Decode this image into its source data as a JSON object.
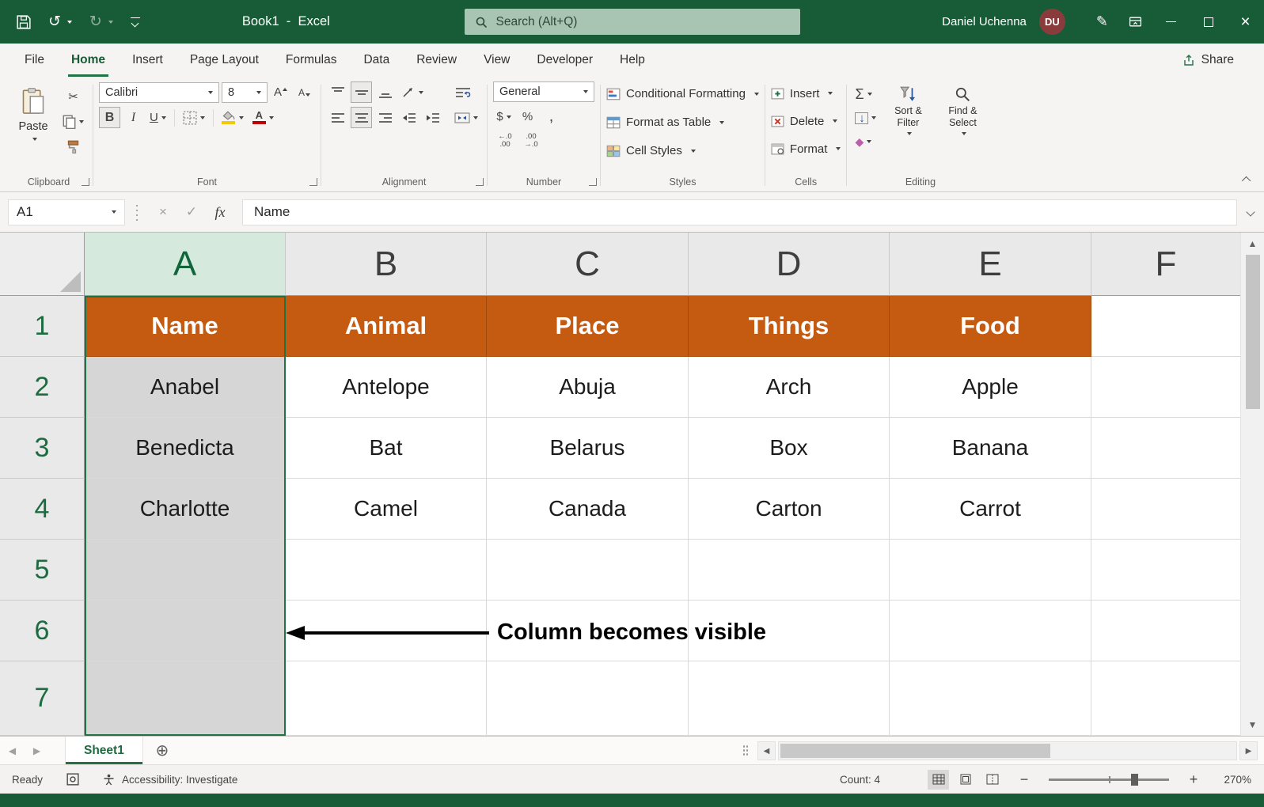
{
  "colors": {
    "title_bar_green": "#185C37",
    "accent_green": "#217346",
    "header_fill_orange": "#C55A11",
    "selected_column_gray": "#D6D6D6",
    "selected_header_green": "#D5E9DD",
    "font_color_bar_red": "#C00000",
    "fill_color_bar_yellow": "#F2C811"
  },
  "title_bar": {
    "title": "Book1  -  Excel",
    "search_placeholder": "Search (Alt+Q)",
    "user_name": "Daniel Uchenna",
    "user_initials": "DU"
  },
  "tabs": {
    "items": [
      "File",
      "Home",
      "Insert",
      "Page Layout",
      "Formulas",
      "Data",
      "Review",
      "View",
      "Developer",
      "Help"
    ],
    "active": "Home",
    "share": "Share"
  },
  "ribbon": {
    "clipboard": {
      "paste": "Paste",
      "label": "Clipboard"
    },
    "font": {
      "name": "Calibri",
      "size": "8",
      "bold": "B",
      "italic": "I",
      "underline": "U",
      "label": "Font"
    },
    "alignment": {
      "label": "Alignment"
    },
    "number": {
      "format": "General",
      "currency": "$",
      "percent": "%",
      "comma": ",",
      "inc_decimal": "←.0\n.00",
      "dec_decimal": ".00\n→.0",
      "label": "Number"
    },
    "styles": {
      "conditional": "Conditional Formatting",
      "format_table": "Format as Table",
      "cell_styles": "Cell Styles",
      "label": "Styles"
    },
    "cells": {
      "insert": "Insert",
      "delete": "Delete",
      "format": "Format",
      "label": "Cells"
    },
    "editing": {
      "autosum": "Σ",
      "fill": "↓",
      "clear": "◆",
      "sort_filter": "Sort & Filter",
      "find_select": "Find & Select",
      "label": "Editing"
    }
  },
  "formula_bar": {
    "name_box": "A1",
    "cancel": "×",
    "enter": "✓",
    "fx": "fx",
    "content": "Name"
  },
  "sheet": {
    "col_headers": [
      "A",
      "B",
      "C",
      "D",
      "E",
      "F"
    ],
    "row_headers": [
      "1",
      "2",
      "3",
      "4",
      "5",
      "6",
      "7"
    ],
    "rows": [
      [
        "Name",
        "Animal",
        "Place",
        "Things",
        "Food"
      ],
      [
        "Anabel",
        "Antelope",
        "Abuja",
        "Arch",
        "Apple"
      ],
      [
        "Benedicta",
        "Bat",
        "Belarus",
        "Box",
        "Banana"
      ],
      [
        "Charlotte",
        "Camel",
        "Canada",
        "Carton",
        "Carrot"
      ],
      [
        "",
        "",
        "",
        "",
        ""
      ],
      [
        "",
        "",
        "",
        "",
        ""
      ],
      [
        "",
        "",
        "",
        "",
        ""
      ]
    ],
    "annotation": "Column becomes visible"
  },
  "sheet_bar": {
    "active_tab": "Sheet1",
    "add_sheet": "⊕",
    "nav_left": "◀",
    "nav_right": "▶"
  },
  "status_bar": {
    "ready": "Ready",
    "accessibility": "Accessibility: Investigate",
    "count": "Count: 4",
    "zoom_out": "−",
    "zoom_in": "+",
    "zoom": "270%"
  },
  "glyphs": {
    "undo": "↺",
    "redo": "↻",
    "cut": "✂",
    "pen": "✎",
    "close": "×",
    "cap_a": "A",
    "scroll_up": "▲",
    "scroll_down": "▼",
    "scroll_left": "◀",
    "scroll_right": "▶"
  }
}
